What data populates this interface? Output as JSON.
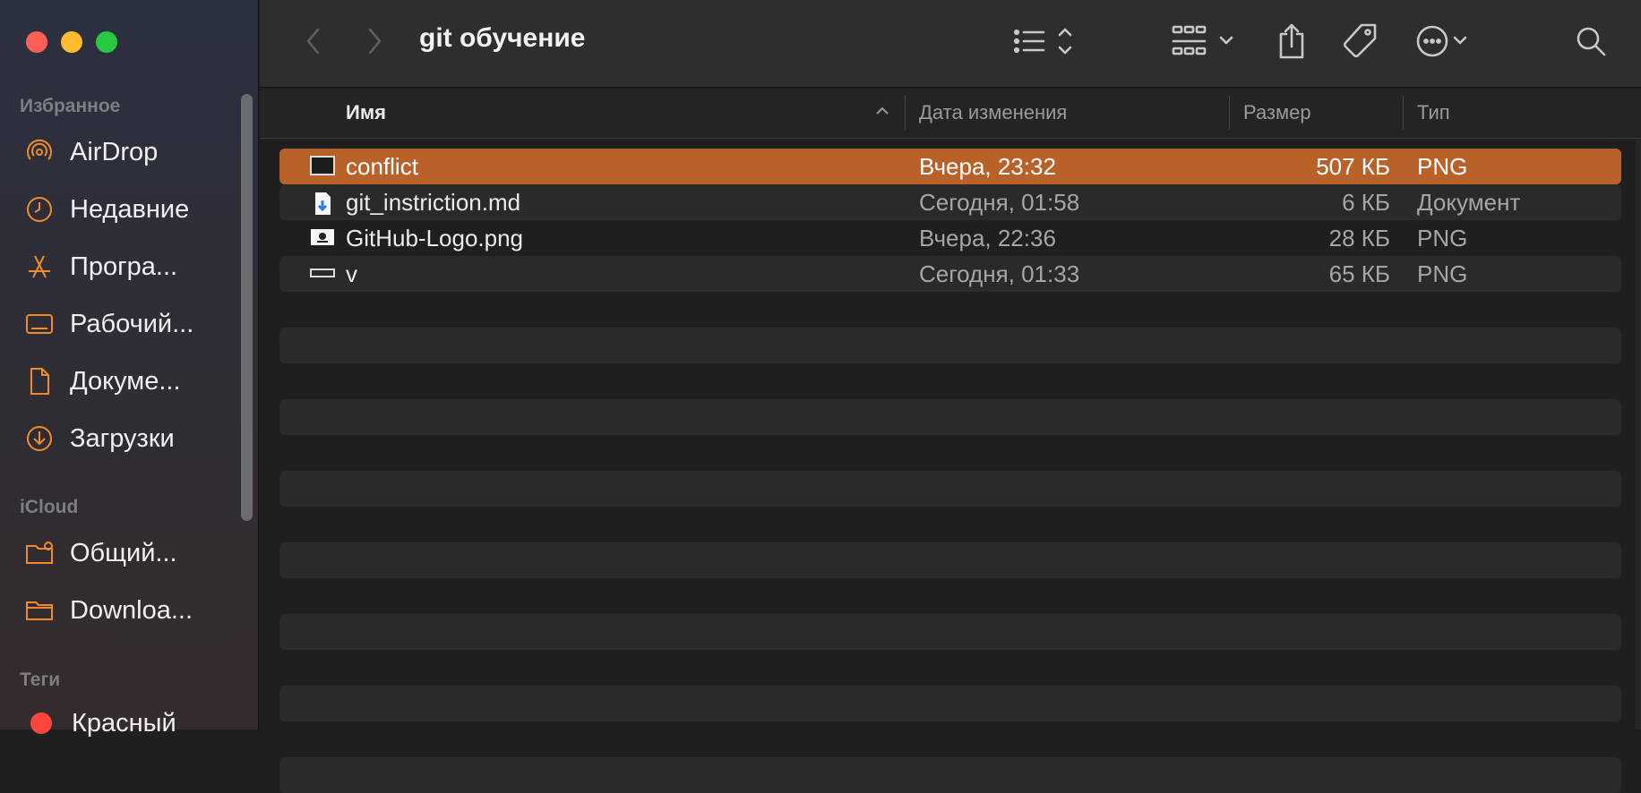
{
  "window": {
    "title": "git обучение"
  },
  "sidebar": {
    "favorites_header": "Избранное",
    "favorites": [
      {
        "label": "AirDrop",
        "icon": "airdrop-icon"
      },
      {
        "label": "Недавние",
        "icon": "clock-icon"
      },
      {
        "label": "Програ...",
        "icon": "applications-icon"
      },
      {
        "label": "Рабочий...",
        "icon": "desktop-icon"
      },
      {
        "label": "Докуме...",
        "icon": "document-icon"
      },
      {
        "label": "Загрузки",
        "icon": "download-icon"
      }
    ],
    "icloud_header": "iCloud",
    "icloud": [
      {
        "label": "Общий...",
        "icon": "shared-folder-icon"
      },
      {
        "label": "Downloa...",
        "icon": "folder-icon"
      }
    ],
    "tags_header": "Теги",
    "tags": [
      {
        "label": "Красный",
        "color": "#ff453a"
      }
    ]
  },
  "columns": {
    "name": "Имя",
    "date": "Дата изменения",
    "size": "Размер",
    "type": "Тип"
  },
  "files": [
    {
      "name": "conflict",
      "date": "Вчера, 23:32",
      "size": "507 КБ",
      "type": "PNG",
      "selected": true,
      "icon": "image-file-icon"
    },
    {
      "name": "git_instriction.md",
      "date": "Сегодня, 01:58",
      "size": "6 КБ",
      "type": "Документ",
      "selected": false,
      "icon": "markdown-file-icon"
    },
    {
      "name": "GitHub-Logo.png",
      "date": "Вчера, 22:36",
      "size": "28 КБ",
      "type": "PNG",
      "selected": false,
      "icon": "image-file-icon"
    },
    {
      "name": "v",
      "date": "Сегодня, 01:33",
      "size": "65 КБ",
      "type": "PNG",
      "selected": false,
      "icon": "image-file-icon"
    }
  ],
  "colors": {
    "accent": "#f08a2a",
    "selection": "#b8622a",
    "sidebar_bg_top": "#2b3140",
    "window_bg": "#1f1f1f"
  }
}
